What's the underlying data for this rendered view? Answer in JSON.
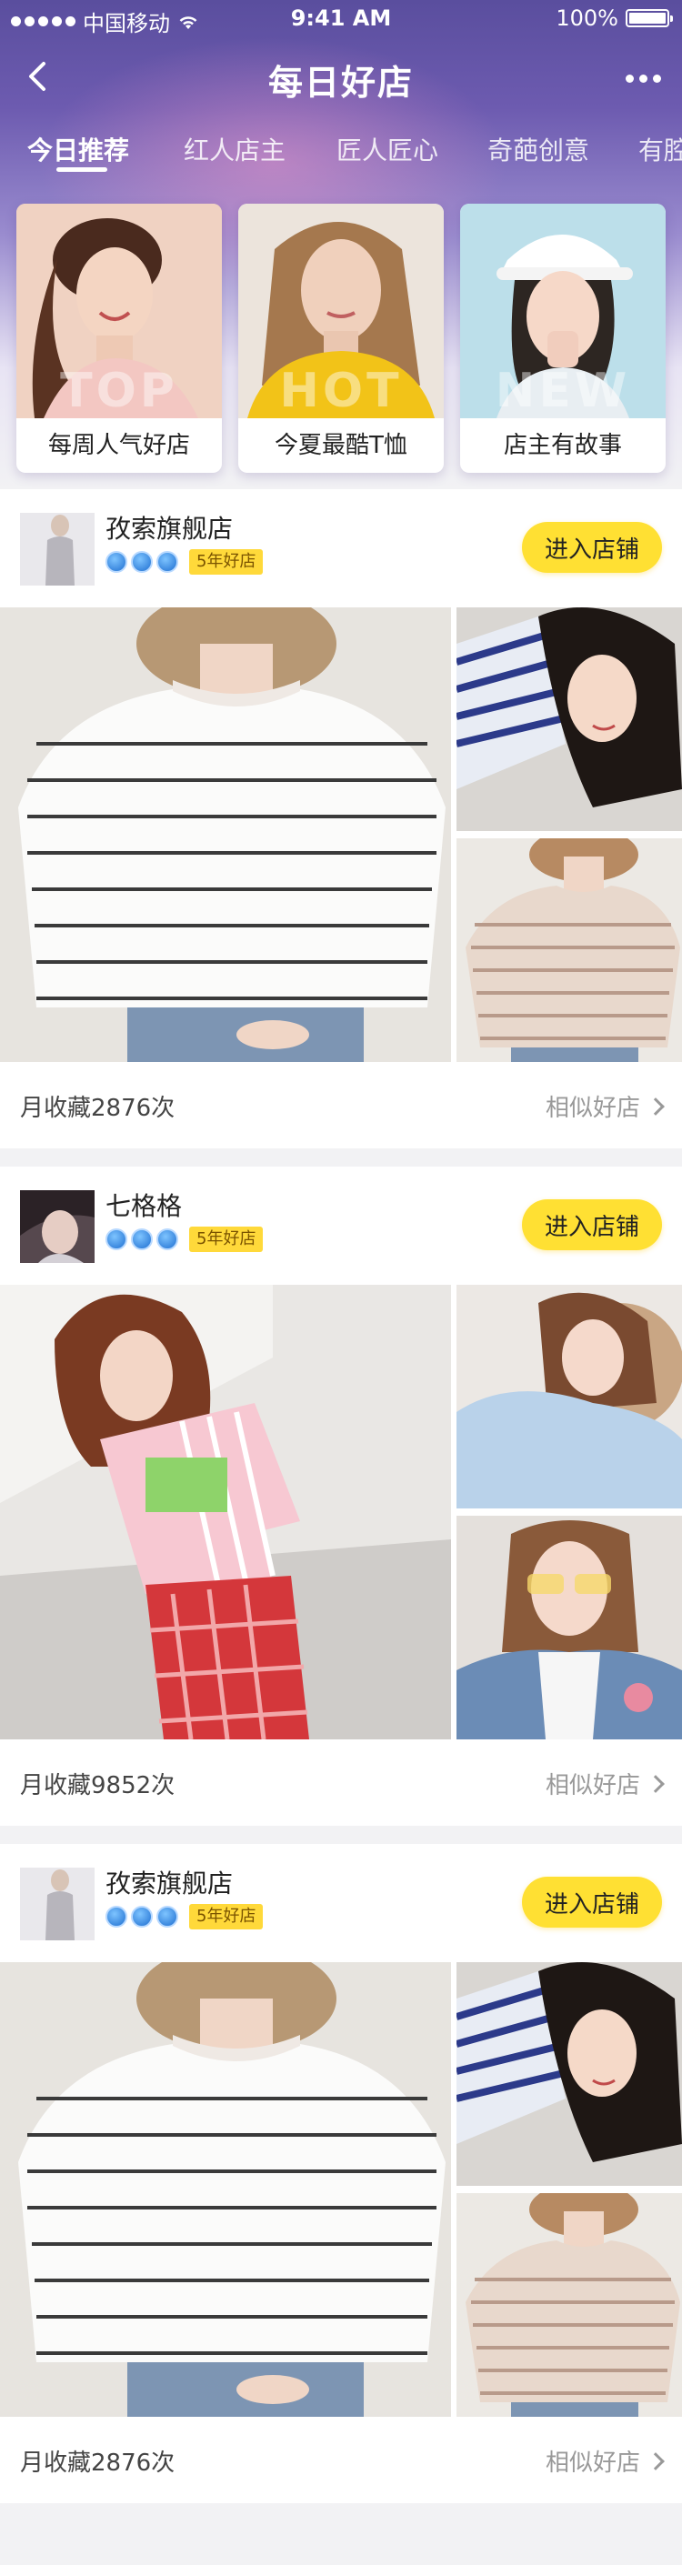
{
  "status_bar": {
    "carrier": "中国移动",
    "time": "9:41 AM",
    "battery": "100%",
    "battery_level": 1.0
  },
  "nav": {
    "title": "每日好店"
  },
  "tabs": [
    {
      "label": "今日推荐",
      "active": true
    },
    {
      "label": "红人店主",
      "active": false
    },
    {
      "label": "匠人匠心",
      "active": false
    },
    {
      "label": "奇葩创意",
      "active": false
    },
    {
      "label": "有腔",
      "active": false
    }
  ],
  "featured": [
    {
      "label": "每周人气好店",
      "overlay": "TOP"
    },
    {
      "label": "今夏最酷T恤",
      "overlay": "HOT"
    },
    {
      "label": "店主有故事",
      "overlay": "NEW"
    }
  ],
  "shops": [
    {
      "name": "孜索旗舰店",
      "medals": 3,
      "badge": "5年好店",
      "enter": "进入店铺",
      "favorites": "月收藏2876次",
      "similar": "相似好店"
    },
    {
      "name": "七格格",
      "medals": 3,
      "badge": "5年好店",
      "enter": "进入店铺",
      "favorites": "月收藏9852次",
      "similar": "相似好店"
    },
    {
      "name": "孜索旗舰店",
      "medals": 3,
      "badge": "5年好店",
      "enter": "进入店铺",
      "favorites": "月收藏2876次",
      "similar": "相似好店"
    }
  ],
  "colors": {
    "accent_yellow": "#ffe033",
    "header_purple": "#6d5bb0",
    "badge_yellow": "#ffd93a"
  }
}
